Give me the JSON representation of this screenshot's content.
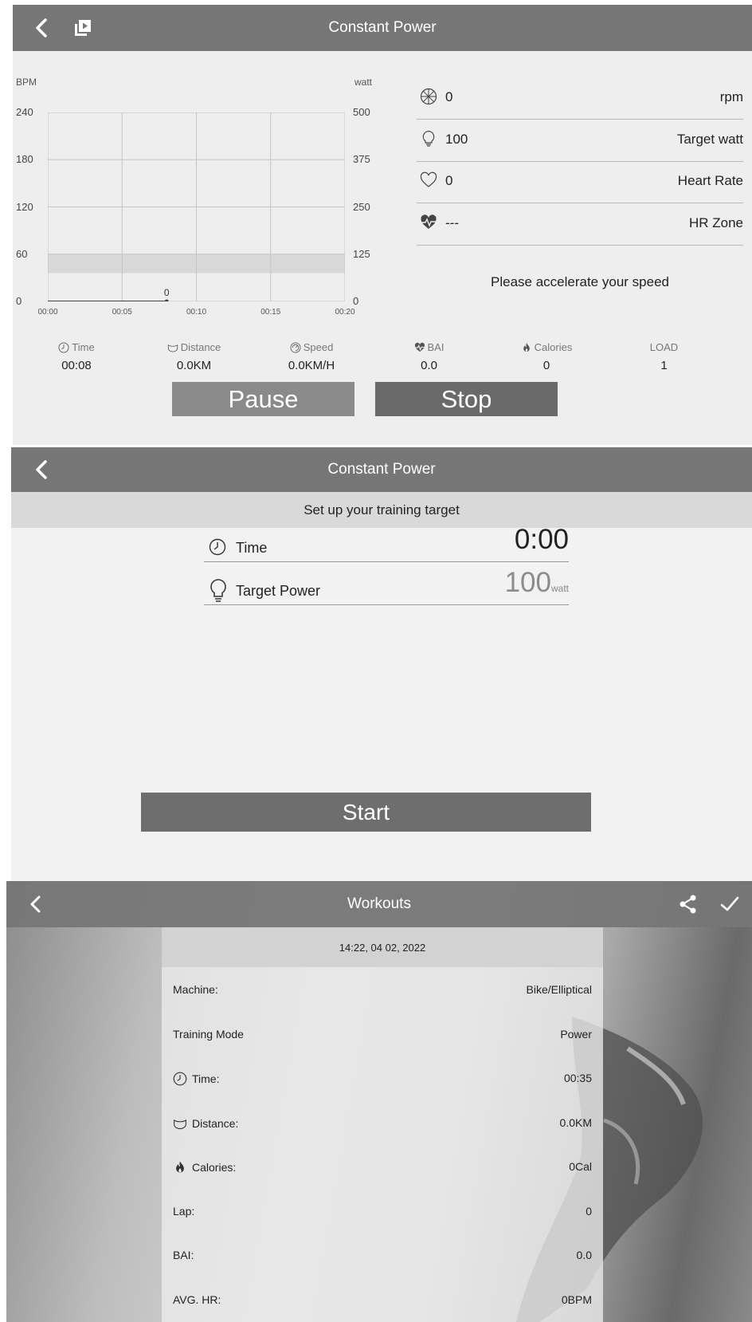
{
  "screen1": {
    "title": "Constant Power",
    "chart_data": {
      "type": "line",
      "ylabel_left": "BPM",
      "ylabel_right": "watt",
      "y_left_ticks": [
        "240",
        "180",
        "120",
        "60",
        "0"
      ],
      "y_right_ticks": [
        "500",
        "375",
        "250",
        "125",
        "0"
      ],
      "x_ticks": [
        "00:00",
        "00:05",
        "00:10",
        "00:15",
        "00:20"
      ],
      "ylim_left": [
        0,
        240
      ],
      "ylim_right": [
        0,
        500
      ],
      "target_band_bpm": [
        36,
        60
      ],
      "series": [
        {
          "x": [
            "00:00",
            "00:08"
          ],
          "values": [
            0,
            0
          ]
        }
      ],
      "point_label": "0",
      "grid": true
    },
    "readouts": [
      {
        "icon": "wheel-icon",
        "value": "0",
        "label": "rpm"
      },
      {
        "icon": "bulb-icon",
        "value": "100",
        "label": "Target watt"
      },
      {
        "icon": "heart-outline-icon",
        "value": "0",
        "label": "Heart Rate"
      },
      {
        "icon": "heart-pulse-icon",
        "value": "---",
        "label": "HR Zone"
      }
    ],
    "message": "Please accelerate your speed",
    "stats": [
      {
        "icon": "clock-icon",
        "caption": "Time",
        "value": "00:08"
      },
      {
        "icon": "distance-icon",
        "caption": "Distance",
        "value": "0.0KM"
      },
      {
        "icon": "speed-icon",
        "caption": "Speed",
        "value": "0.0KM/H"
      },
      {
        "icon": "heart-filled-icon",
        "caption": "BAI",
        "value": "0.0"
      },
      {
        "icon": "flame-icon",
        "caption": "Calories",
        "value": "0"
      },
      {
        "icon": "",
        "caption": "LOAD",
        "value": "1"
      }
    ],
    "pause_label": "Pause",
    "stop_label": "Stop"
  },
  "screen2": {
    "title": "Constant Power",
    "subtitle": "Set up your training target",
    "time_label": "Time",
    "time_value": "0:00",
    "power_label": "Target Power",
    "power_value": "100",
    "power_unit": "watt",
    "start_label": "Start"
  },
  "screen3": {
    "title": "Workouts",
    "date": "14:22, 04 02, 2022",
    "rows": [
      {
        "icon": "",
        "label": "Machine:",
        "value": "Bike/Elliptical"
      },
      {
        "icon": "",
        "label": "Training Mode",
        "value": "Power"
      },
      {
        "icon": "clock-icon",
        "label": "Time:",
        "value": "00:35"
      },
      {
        "icon": "distance-icon",
        "label": "Distance:",
        "value": "0.0KM"
      },
      {
        "icon": "flame-icon",
        "label": "Calories:",
        "value": "0Cal"
      },
      {
        "icon": "",
        "label": "Lap:",
        "value": "0"
      },
      {
        "icon": "",
        "label": "BAI:",
        "value": "0.0"
      },
      {
        "icon": "",
        "label": "AVG. HR:",
        "value": "0BPM"
      }
    ]
  },
  "colors": {
    "appbar": "#767676",
    "pause_button": "#8a8a8a",
    "stop_button": "#6a6a6a",
    "start_button": "#6e6e6e",
    "target_band": "#d8d8d8"
  }
}
